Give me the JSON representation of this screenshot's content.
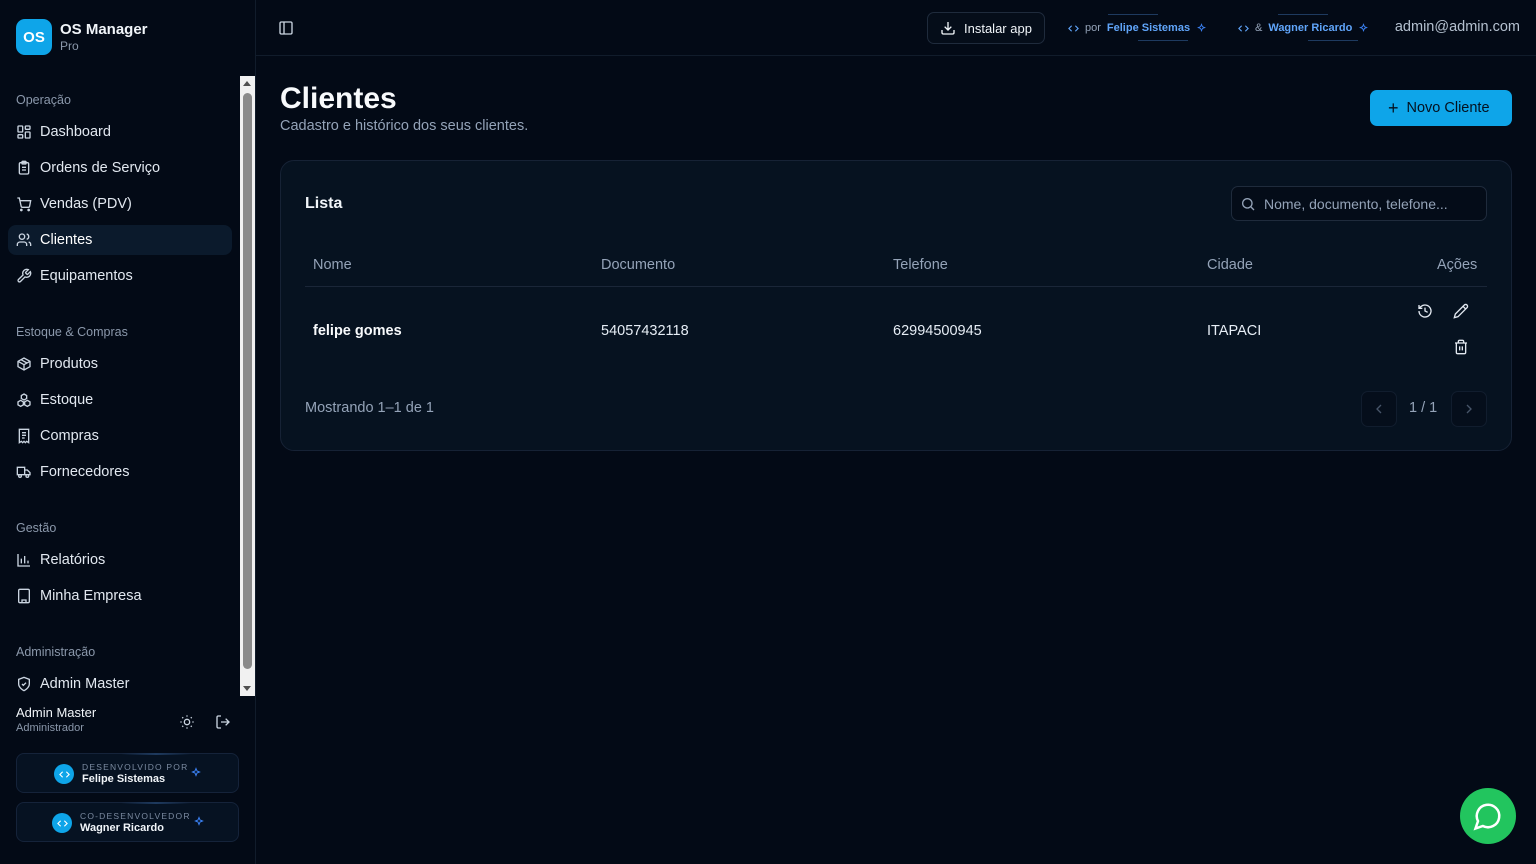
{
  "brand": {
    "logo": "OS",
    "name": "OS Manager",
    "tier": "Pro"
  },
  "nav": {
    "sections": [
      {
        "label": "Operação",
        "items": [
          {
            "label": "Dashboard",
            "icon": "dashboard-icon"
          },
          {
            "label": "Ordens de Serviço",
            "icon": "clipboard-icon"
          },
          {
            "label": "Vendas (PDV)",
            "icon": "cart-icon"
          },
          {
            "label": "Clientes",
            "icon": "users-icon",
            "active": true
          },
          {
            "label": "Equipamentos",
            "icon": "wrench-icon"
          }
        ]
      },
      {
        "label": "Estoque & Compras",
        "items": [
          {
            "label": "Produtos",
            "icon": "package-icon"
          },
          {
            "label": "Estoque",
            "icon": "boxes-icon"
          },
          {
            "label": "Compras",
            "icon": "receipt-icon"
          },
          {
            "label": "Fornecedores",
            "icon": "truck-icon"
          }
        ]
      },
      {
        "label": "Gestão",
        "items": [
          {
            "label": "Relatórios",
            "icon": "bar-chart-icon"
          },
          {
            "label": "Minha Empresa",
            "icon": "building-icon"
          }
        ]
      },
      {
        "label": "Administração",
        "items": [
          {
            "label": "Admin Master",
            "icon": "shield-icon"
          }
        ]
      }
    ]
  },
  "user": {
    "name": "Admin Master",
    "role": "Administrador"
  },
  "dev_cards": [
    {
      "label": "DESENVOLVIDO POR",
      "name": "Felipe Sistemas"
    },
    {
      "label": "CO-DESENVOLVEDOR",
      "name": "Wagner Ricardo"
    }
  ],
  "topbar": {
    "install_label": "Instalar app",
    "credit1": {
      "prefix": "por",
      "name": "Felipe Sistemas"
    },
    "credit2": {
      "prefix": "&",
      "name": "Wagner Ricardo"
    },
    "email": "admin@admin.com"
  },
  "page": {
    "title": "Clientes",
    "subtitle": "Cadastro e histórico dos seus clientes.",
    "new_button": "Novo Cliente"
  },
  "list": {
    "title": "Lista",
    "search_placeholder": "Nome, documento, telefone...",
    "columns": [
      "Nome",
      "Documento",
      "Telefone",
      "Cidade",
      "Ações"
    ],
    "rows": [
      {
        "nome": "felipe gomes",
        "documento": "54057432118",
        "telefone": "62994500945",
        "cidade": "ITAPACI"
      }
    ],
    "showing": "Mostrando 1–1 de 1",
    "page_indicator": "1 / 1"
  },
  "colors": {
    "accent": "#0ea5e9",
    "background": "#030a16",
    "whatsapp": "#22c55e"
  }
}
